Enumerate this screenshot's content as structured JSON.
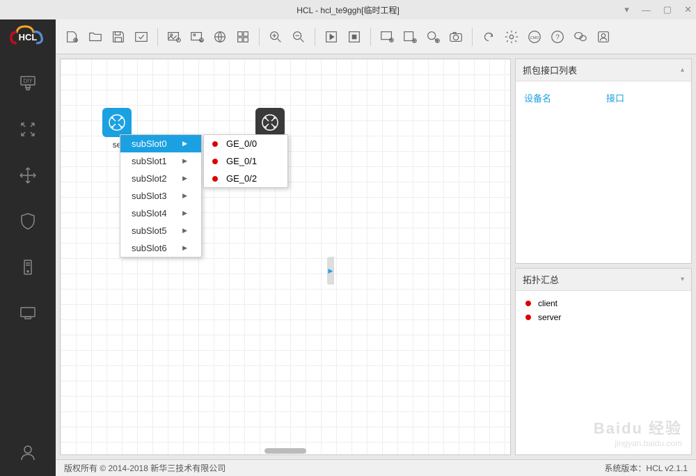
{
  "title": "HCL - hcl_te9ggh[临时工程]",
  "logo_text": "HCL",
  "sidebar": {
    "diy_label": "DIY"
  },
  "devices": {
    "server_label": "se",
    "client_label": ""
  },
  "context_menu": {
    "items": [
      "subSlot0",
      "subSlot1",
      "subSlot2",
      "subSlot3",
      "subSlot4",
      "subSlot5",
      "subSlot6"
    ],
    "selected_index": 0,
    "submenu": [
      "GE_0/0",
      "GE_0/1",
      "GE_0/2"
    ]
  },
  "panels": {
    "capture": {
      "title": "抓包接口列表",
      "col1": "设备名",
      "col2": "接口"
    },
    "topology": {
      "title": "拓扑汇总",
      "items": [
        "client",
        "server"
      ]
    }
  },
  "statusbar": {
    "copyright": "版权所有 © 2014-2018 新华三技术有限公司",
    "version_label": "系统版本：HCL v2.1.1"
  },
  "watermark": {
    "line1": "Baidu 经验",
    "line2": "jingyan.baidu.com"
  }
}
